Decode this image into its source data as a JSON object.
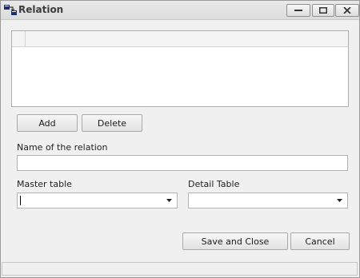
{
  "window": {
    "title": "Relation",
    "icon": "relation-table-icon",
    "controls": [
      "minimize-icon",
      "maximize-icon",
      "close-icon"
    ]
  },
  "grid": {
    "columns": [],
    "rows": []
  },
  "buttons": {
    "add": "Add",
    "delete": "Delete",
    "save_and_close": "Save and Close",
    "cancel": "Cancel"
  },
  "fields": {
    "relation_name_label": "Name of the relation",
    "relation_name_value": "",
    "master_table_label": "Master table",
    "master_table_value": "",
    "detail_table_label": "Detail Table",
    "detail_table_value": ""
  },
  "status": {
    "text": ""
  },
  "colors": {
    "window_bg": "#f0f0f0",
    "title_text": "#3c3c3c",
    "border": "#a9a9a9"
  }
}
